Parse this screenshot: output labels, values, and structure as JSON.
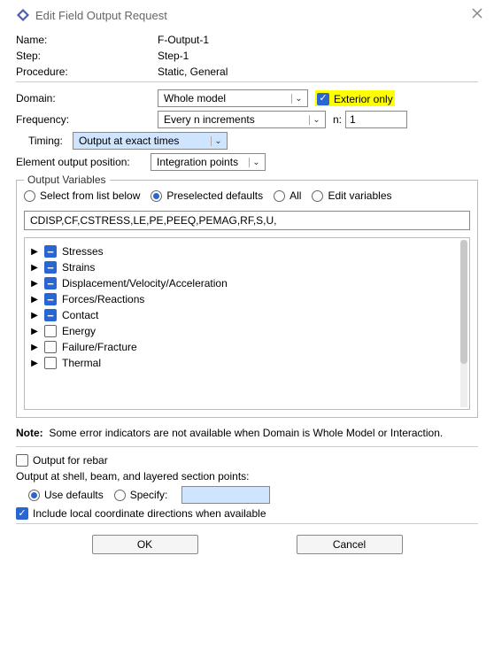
{
  "title": "Edit Field Output Request",
  "header": {
    "name_label": "Name:",
    "name_value": "F-Output-1",
    "step_label": "Step:",
    "step_value": "Step-1",
    "procedure_label": "Procedure:",
    "procedure_value": "Static, General"
  },
  "domain": {
    "label": "Domain:",
    "value": "Whole model",
    "exterior_label": "Exterior only",
    "exterior_checked": true
  },
  "frequency": {
    "label": "Frequency:",
    "value": "Every n increments",
    "n_label": "n:",
    "n_value": "1"
  },
  "timing": {
    "label": "Timing:",
    "value": "Output at exact times"
  },
  "element_output": {
    "label": "Element output position:",
    "value": "Integration points"
  },
  "output_variables": {
    "legend": "Output Variables",
    "modes": {
      "select_list": "Select from list below",
      "preselected": "Preselected defaults",
      "all": "All",
      "edit": "Edit variables"
    },
    "vars_text": "CDISP,CF,CSTRESS,LE,PE,PEEQ,PEMAG,RF,S,U,",
    "tree": [
      {
        "label": "Stresses",
        "state": "partial"
      },
      {
        "label": "Strains",
        "state": "partial"
      },
      {
        "label": "Displacement/Velocity/Acceleration",
        "state": "partial"
      },
      {
        "label": "Forces/Reactions",
        "state": "partial"
      },
      {
        "label": "Contact",
        "state": "partial"
      },
      {
        "label": "Energy",
        "state": "empty"
      },
      {
        "label": "Failure/Fracture",
        "state": "empty"
      },
      {
        "label": "Thermal",
        "state": "empty"
      }
    ]
  },
  "note": {
    "prefix": "Note:",
    "text": "Some error indicators are not available when Domain is Whole Model or Interaction."
  },
  "rebar": {
    "label": "Output for rebar",
    "checked": false
  },
  "section_points": {
    "label": "Output at shell, beam, and layered section points:",
    "use_defaults": "Use defaults",
    "specify": "Specify:"
  },
  "local_coord": {
    "label": "Include local coordinate directions when available",
    "checked": true
  },
  "buttons": {
    "ok": "OK",
    "cancel": "Cancel"
  }
}
